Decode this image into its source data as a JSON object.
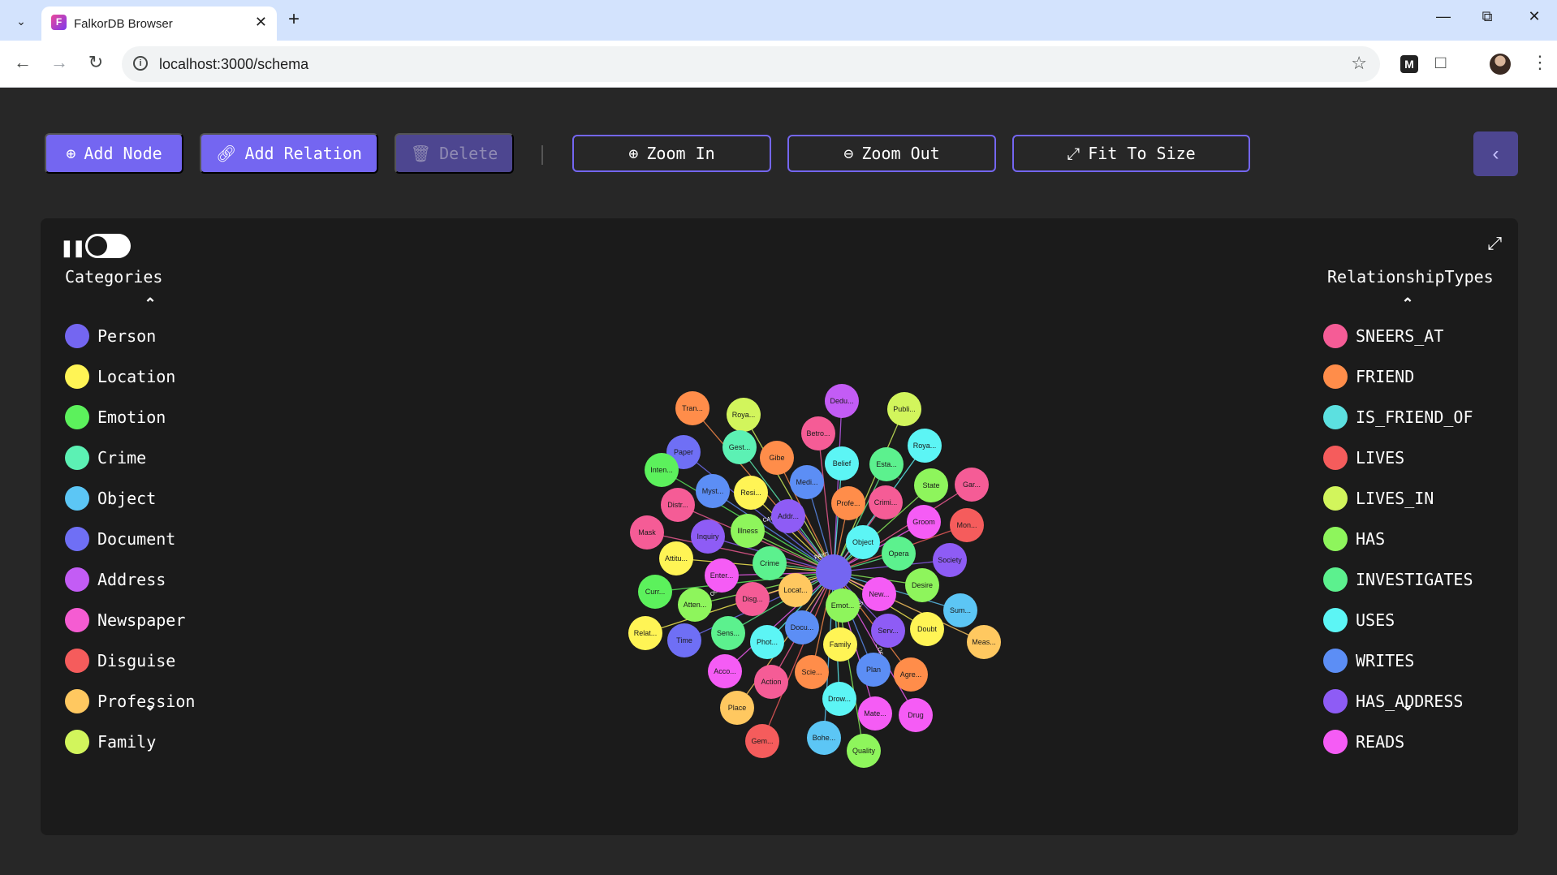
{
  "browser": {
    "tab_title": "FalkorDB Browser",
    "favicon_letter": "F",
    "url": "localhost:3000/schema",
    "ext_m": "M"
  },
  "toolbar": {
    "add_node": "Add Node",
    "add_relation": "Add Relation",
    "delete": "Delete",
    "zoom_in": "Zoom In",
    "zoom_out": "Zoom Out",
    "fit_to_size": "Fit To Size"
  },
  "categories": {
    "title": "Categories",
    "items": [
      {
        "label": "Person",
        "color": "#7466f1"
      },
      {
        "label": "Location",
        "color": "#fff455"
      },
      {
        "label": "Emotion",
        "color": "#5cf15c"
      },
      {
        "label": "Crime",
        "color": "#5cf1b4"
      },
      {
        "label": "Object",
        "color": "#5cc6f5"
      },
      {
        "label": "Document",
        "color": "#6f6ff5"
      },
      {
        "label": "Address",
        "color": "#c35cf5"
      },
      {
        "label": "Newspaper",
        "color": "#f55cd2"
      },
      {
        "label": "Disguise",
        "color": "#f55c5c"
      },
      {
        "label": "Profession",
        "color": "#ffc860"
      },
      {
        "label": "Family",
        "color": "#d2f55c"
      }
    ]
  },
  "relationships": {
    "title": "RelationshipTypes",
    "items": [
      {
        "label": "SNEERS_AT",
        "color": "#f55c96"
      },
      {
        "label": "FRIEND",
        "color": "#ff8d4a"
      },
      {
        "label": "IS_FRIEND_OF",
        "color": "#5ce0e0"
      },
      {
        "label": "LIVES",
        "color": "#f55c5c"
      },
      {
        "label": "LIVES_IN",
        "color": "#d2f55c"
      },
      {
        "label": "HAS",
        "color": "#8ef55c"
      },
      {
        "label": "INVESTIGATES",
        "color": "#5cf18e"
      },
      {
        "label": "USES",
        "color": "#5cf5f5"
      },
      {
        "label": "WRITES",
        "color": "#5c8ef5"
      },
      {
        "label": "HAS_ADDRESS",
        "color": "#8e5cf5"
      },
      {
        "label": "READS",
        "color": "#f55cf5"
      }
    ]
  },
  "graph": {
    "center_color": "#7466f1",
    "edge_labels": [
      "PAYS",
      "CAUSES",
      "IS_AB...",
      "OCCURS_AT",
      "MADE_OF",
      "OWNS"
    ],
    "nodes": [
      {
        "label": "Tran...",
        "color": "#ff8d4a"
      },
      {
        "label": "Roya...",
        "color": "#d2f55c"
      },
      {
        "label": "Dedu...",
        "color": "#c35cf5"
      },
      {
        "label": "Publi...",
        "color": "#d2f55c"
      },
      {
        "label": "Betro...",
        "color": "#f55c96"
      },
      {
        "label": "Gest...",
        "color": "#5cf1b4"
      },
      {
        "label": "Paper",
        "color": "#6f6ff5"
      },
      {
        "label": "Gibe",
        "color": "#ff8d4a"
      },
      {
        "label": "Belief",
        "color": "#5cf5f5"
      },
      {
        "label": "Esta...",
        "color": "#5cf18e"
      },
      {
        "label": "Roya...",
        "color": "#5cf5f5"
      },
      {
        "label": "Inten...",
        "color": "#5cf15c"
      },
      {
        "label": "Myst...",
        "color": "#5c8ef5"
      },
      {
        "label": "Resi...",
        "color": "#fff455"
      },
      {
        "label": "Medi...",
        "color": "#5c8ef5"
      },
      {
        "label": "State",
        "color": "#8ef55c"
      },
      {
        "label": "Gar...",
        "color": "#f55c96"
      },
      {
        "label": "Distr...",
        "color": "#f55c96"
      },
      {
        "label": "Addr...",
        "color": "#8e5cf5"
      },
      {
        "label": "Profe...",
        "color": "#ff8d4a"
      },
      {
        "label": "Crimi...",
        "color": "#f55c96"
      },
      {
        "label": "Groom",
        "color": "#f55cf5"
      },
      {
        "label": "Mon...",
        "color": "#f55c5c"
      },
      {
        "label": "Mask",
        "color": "#f55c96"
      },
      {
        "label": "Inquiry",
        "color": "#8e5cf5"
      },
      {
        "label": "Illness",
        "color": "#8ef55c"
      },
      {
        "label": "Object",
        "color": "#5cf5f5"
      },
      {
        "label": "Attitu...",
        "color": "#fff455"
      },
      {
        "label": "Crime",
        "color": "#5cf18e"
      },
      {
        "label": "Opera",
        "color": "#5cf18e"
      },
      {
        "label": "Society",
        "color": "#8e5cf5"
      },
      {
        "label": "Enter...",
        "color": "#f55cf5"
      },
      {
        "label": "Locat...",
        "color": "#ffc860"
      },
      {
        "label": "Desire",
        "color": "#8ef55c"
      },
      {
        "label": "Curr...",
        "color": "#5cf15c"
      },
      {
        "label": "Disg...",
        "color": "#f55c96"
      },
      {
        "label": "New...",
        "color": "#f55cf5"
      },
      {
        "label": "Sum...",
        "color": "#5cc6f5"
      },
      {
        "label": "Atten...",
        "color": "#8ef55c"
      },
      {
        "label": "Emot...",
        "color": "#8ef55c"
      },
      {
        "label": "Relat...",
        "color": "#fff455"
      },
      {
        "label": "Time",
        "color": "#6f6ff5"
      },
      {
        "label": "Sens...",
        "color": "#5cf18e"
      },
      {
        "label": "Docu...",
        "color": "#5c8ef5"
      },
      {
        "label": "Serv...",
        "color": "#8e5cf5"
      },
      {
        "label": "Doubt",
        "color": "#fff455"
      },
      {
        "label": "Meas...",
        "color": "#ffc860"
      },
      {
        "label": "Phot...",
        "color": "#5cf5f5"
      },
      {
        "label": "Family",
        "color": "#fff455"
      },
      {
        "label": "Acco...",
        "color": "#f55cf5"
      },
      {
        "label": "Scie...",
        "color": "#ff8d4a"
      },
      {
        "label": "Plan",
        "color": "#5c8ef5"
      },
      {
        "label": "Agre...",
        "color": "#ff8d4a"
      },
      {
        "label": "Action",
        "color": "#f55c96"
      },
      {
        "label": "Place",
        "color": "#ffc860"
      },
      {
        "label": "Drow...",
        "color": "#5cf5f5"
      },
      {
        "label": "Mate...",
        "color": "#f55cf5"
      },
      {
        "label": "Drug",
        "color": "#f55cf5"
      },
      {
        "label": "Gem...",
        "color": "#f55c5c"
      },
      {
        "label": "Bohe...",
        "color": "#5cc6f5"
      },
      {
        "label": "Quality",
        "color": "#8ef55c"
      }
    ]
  }
}
